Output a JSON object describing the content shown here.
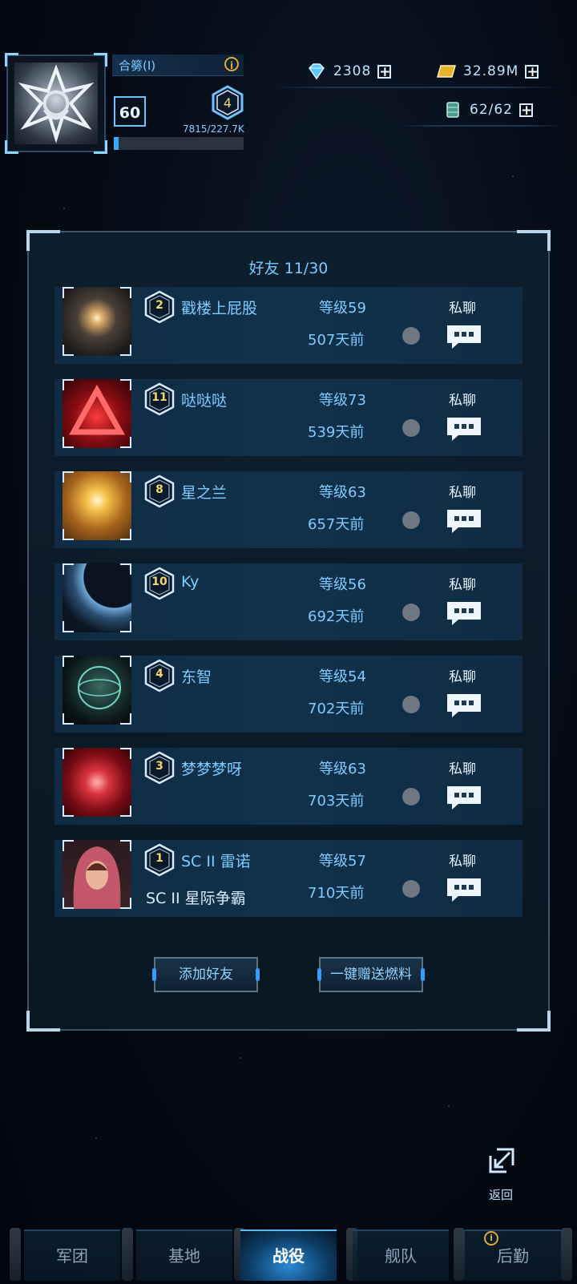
{
  "player": {
    "name": "合簩(I)",
    "level": "60",
    "rank": "4",
    "exp": "7815/227.7K",
    "exp_progress": 0.034
  },
  "resources": {
    "gems": "2308",
    "gold": "32.89M",
    "fuel": "62/62"
  },
  "friends_panel": {
    "title": "好友 11/30",
    "friends": [
      {
        "rank": "2",
        "name": "戳楼上屁股",
        "sub": "",
        "level": "等级59",
        "last_seen": "507天前",
        "chat_label": "私聊",
        "avatar": "starburst"
      },
      {
        "rank": "11",
        "name": "哒哒哒",
        "sub": "",
        "level": "等级73",
        "last_seen": "539天前",
        "chat_label": "私聊",
        "avatar": "red-triangle"
      },
      {
        "rank": "8",
        "name": "星之兰",
        "sub": "",
        "level": "等级63",
        "last_seen": "657天前",
        "chat_label": "私聊",
        "avatar": "golden-sun"
      },
      {
        "rank": "10",
        "name": "Ky",
        "sub": "",
        "level": "等级56",
        "last_seen": "692天前",
        "chat_label": "私聊",
        "avatar": "planet"
      },
      {
        "rank": "4",
        "name": "东智",
        "sub": "",
        "level": "等级54",
        "last_seen": "702天前",
        "chat_label": "私聊",
        "avatar": "green-sphere"
      },
      {
        "rank": "3",
        "name": "梦梦梦呀",
        "sub": "",
        "level": "等级63",
        "last_seen": "703天前",
        "chat_label": "私聊",
        "avatar": "red-emblem"
      },
      {
        "rank": "1",
        "name": "SC II 雷诺",
        "sub": "SC II 星际争霸",
        "level": "等级57",
        "last_seen": "710天前",
        "chat_label": "私聊",
        "avatar": "hooded-woman"
      }
    ],
    "add_friend_label": "添加好友",
    "gift_fuel_label": "一键赠送燃料"
  },
  "back_label": "返回",
  "nav": {
    "tabs": [
      "军团",
      "基地",
      "战役",
      "舰队",
      "后勤"
    ],
    "active": "战役"
  },
  "colors": {
    "accent": "#7fcbff",
    "panel_bg": "#0f2c44",
    "badge": "#f2d66a",
    "notice": "#e1a93b"
  }
}
